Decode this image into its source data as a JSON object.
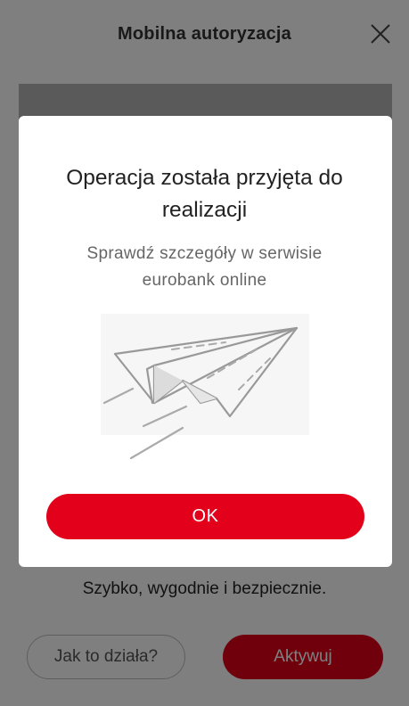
{
  "header": {
    "title": "Mobilna autoryzacja",
    "close_icon": "close-icon"
  },
  "tagline": "Szybko, wygodnie i bezpiecznie.",
  "actions": {
    "how_it_works_label": "Jak to działa?",
    "activate_label": "Aktywuj"
  },
  "modal": {
    "title_line1": "Operacja została przyjęta do",
    "title_line2": "realizacji",
    "subtitle_line1": "Sprawdź szczegóły w serwisie",
    "subtitle_line2": "eurobank online",
    "illustration_icon": "paper-plane-icon",
    "ok_label": "OK"
  },
  "colors": {
    "brand": "#e2001a",
    "overlay": "rgba(0,0,0,0.5)"
  }
}
